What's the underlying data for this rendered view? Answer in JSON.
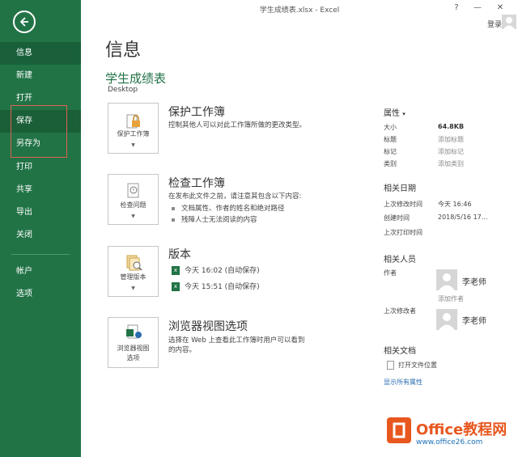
{
  "window": {
    "title": "学生成绩表.xlsx - Excel",
    "help": "?",
    "minimize": "—",
    "close": "✕",
    "login": "登录"
  },
  "sidebar": {
    "items": [
      {
        "label": "信息"
      },
      {
        "label": "新建"
      },
      {
        "label": "打开"
      },
      {
        "label": "保存"
      },
      {
        "label": "另存为"
      },
      {
        "label": "打印"
      },
      {
        "label": "共享"
      },
      {
        "label": "导出"
      },
      {
        "label": "关闭"
      },
      {
        "label": "帐户"
      },
      {
        "label": "选项"
      }
    ]
  },
  "main": {
    "page_title": "信息",
    "doc_name": "学生成绩表",
    "doc_location": "Desktop",
    "protect": {
      "button": "保护工作簿",
      "title": "保护工作簿",
      "desc": "控制其他人可以对此工作簿所做的更改类型。"
    },
    "inspect": {
      "button": "检查问题",
      "title": "检查工作簿",
      "desc": "在发布此文件之前，请注意其包含以下内容:",
      "bullets": [
        "文档属性、作者的姓名和绝对路径",
        "残障人士无法阅读的内容"
      ]
    },
    "versions": {
      "button": "管理版本",
      "title": "版本",
      "rows": [
        "今天 16:02 (自动保存)",
        "今天 15:51 (自动保存)"
      ]
    },
    "browser": {
      "button_line1": "浏览器视图",
      "button_line2": "选项",
      "title": "浏览器视图选项",
      "desc": "选择在 Web 上查看此工作簿时用户可以看到的内容。"
    }
  },
  "properties": {
    "header": "属性",
    "size_label": "大小",
    "size_value": "64.8KB",
    "title_label": "标题",
    "title_value": "添加标题",
    "tags_label": "标记",
    "tags_value": "添加标记",
    "category_label": "类别",
    "category_value": "添加类别",
    "dates_header": "相关日期",
    "modified_label": "上次修改时间",
    "modified_value": "今天 16:46",
    "created_label": "创建时间",
    "created_value": "2018/5/16 17...",
    "printed_label": "上次打印时间",
    "people_header": "相关人员",
    "author_label": "作者",
    "author_name": "李老师",
    "add_author": "添加作者",
    "modifier_label": "上次修改者",
    "modifier_name": "李老师",
    "docs_header": "相关文档",
    "open_location": "打开文件位置",
    "show_all": "显示所有属性"
  },
  "watermark": {
    "title": "Office教程网",
    "url": "www.office26.com"
  },
  "colors": {
    "accent": "#217346",
    "watermark": "#e8571e"
  }
}
